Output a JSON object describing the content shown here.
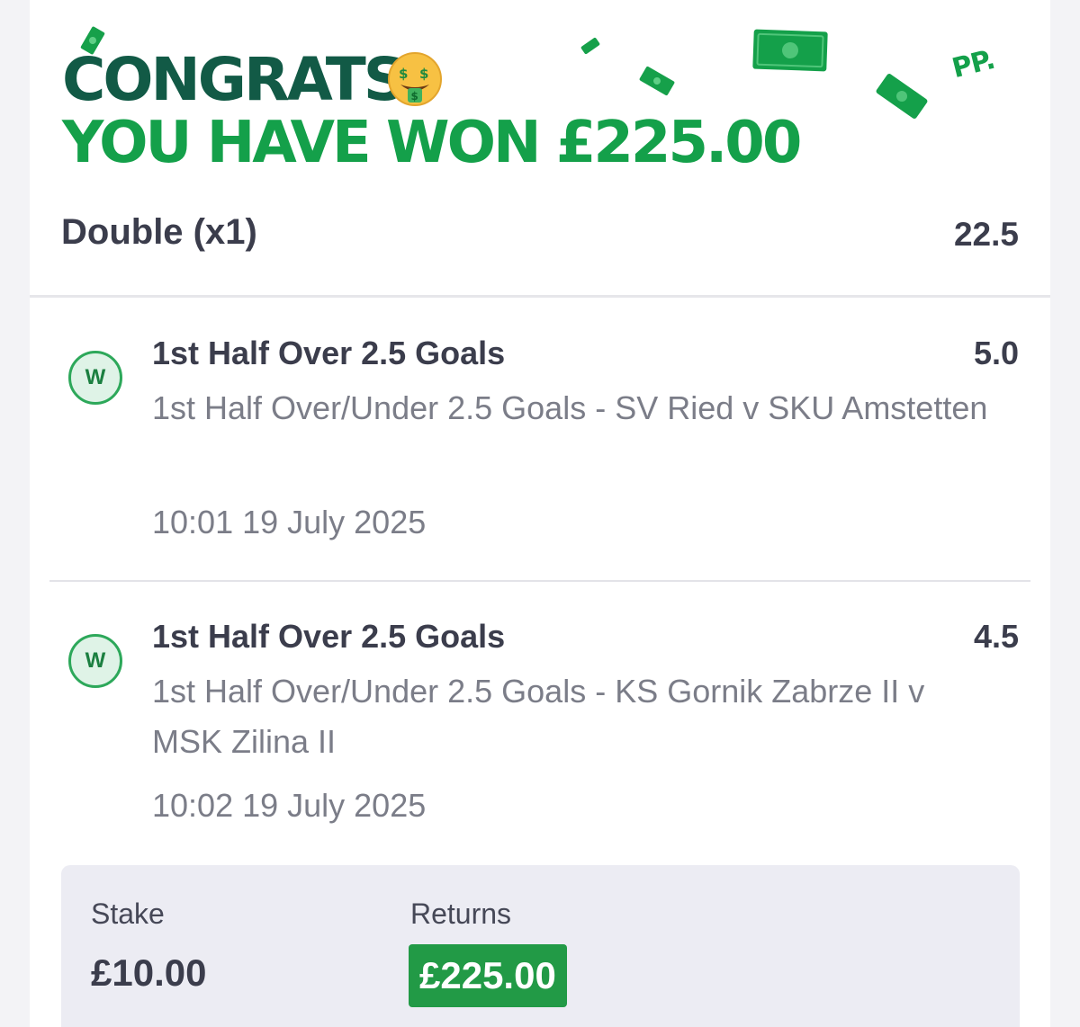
{
  "header": {
    "title": "CONGRATS!",
    "subtitle": "YOU HAVE WON £225.00",
    "emoji": "money-mouth-face",
    "logo_text": "PP."
  },
  "bet": {
    "type": "Double (x1)",
    "total_odds": "22.5"
  },
  "selections": [
    {
      "status": "W",
      "name": "1st Half Over 2.5 Goals",
      "odds": "5.0",
      "market": "1st Half Over/Under 2.5 Goals - SV Ried v SKU Amstetten",
      "datetime": "10:01 19 July 2025"
    },
    {
      "status": "W",
      "name": "1st Half Over 2.5 Goals",
      "odds": "4.5",
      "market": "1st Half Over/Under 2.5 Goals - KS Gornik Zabrze II v MSK Zilina II",
      "datetime": "10:02 19 July 2025"
    }
  ],
  "summary": {
    "stake_label": "Stake",
    "stake_value": "£10.00",
    "returns_label": "Returns",
    "returns_value": "£225.00"
  },
  "colors": {
    "dark_green": "#125a46",
    "brand_green": "#14a04a",
    "returns_green": "#229a46"
  }
}
